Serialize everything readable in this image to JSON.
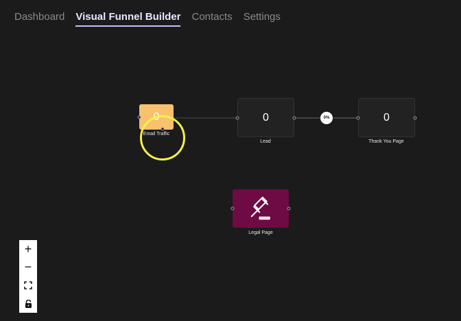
{
  "nav": {
    "items": [
      {
        "label": "Dashboard",
        "active": false
      },
      {
        "label": "Visual Funnel Builder",
        "active": true
      },
      {
        "label": "Contacts",
        "active": false
      },
      {
        "label": "Settings",
        "active": false
      }
    ]
  },
  "nodes": {
    "email_traffic": {
      "count": "0",
      "label": "Email Traffic",
      "color": "#f7c16e"
    },
    "lead": {
      "count": "0",
      "label": "Lead"
    },
    "thank_you": {
      "count": "0",
      "label": "Thank You Page"
    },
    "legal": {
      "label": "Legal Page",
      "icon": "gavel-icon",
      "color": "#6e0b44"
    }
  },
  "edges": {
    "lead_to_thank_you_rate": "0%"
  },
  "controls": {
    "zoom_in": "+",
    "zoom_out": "−",
    "fit_view_icon": "fit-view-icon",
    "lock_icon": "lock-icon"
  }
}
